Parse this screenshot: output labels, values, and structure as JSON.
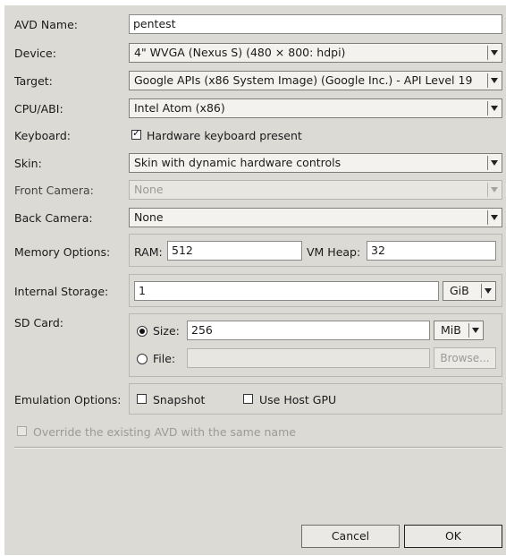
{
  "form": {
    "avd_name_label": "AVD Name:",
    "avd_name_value": "pentest",
    "device_label": "Device:",
    "device_value": "4\" WVGA (Nexus S) (480 × 800: hdpi)",
    "target_label": "Target:",
    "target_value": "Google APIs (x86 System Image) (Google Inc.) - API Level 19",
    "cpu_label": "CPU/ABI:",
    "cpu_value": "Intel Atom (x86)",
    "keyboard_label": "Keyboard:",
    "keyboard_checkbox_label": "Hardware keyboard present",
    "keyboard_checked": true,
    "skin_label": "Skin:",
    "skin_value": "Skin with dynamic hardware controls",
    "front_camera_label": "Front Camera:",
    "front_camera_value": "None",
    "back_camera_label": "Back Camera:",
    "back_camera_value": "None",
    "memory_label": "Memory Options:",
    "ram_label": "RAM:",
    "ram_value": "512",
    "vm_heap_label": "VM Heap:",
    "vm_heap_value": "32",
    "internal_storage_label": "Internal Storage:",
    "internal_storage_value": "1",
    "internal_storage_unit": "GiB",
    "sd_card_label": "SD Card:",
    "sd_size_label": "Size:",
    "sd_size_value": "256",
    "sd_size_unit": "MiB",
    "sd_file_label": "File:",
    "browse_label": "Browse...",
    "emulation_label": "Emulation Options:",
    "snapshot_label": "Snapshot",
    "use_host_gpu_label": "Use Host GPU",
    "override_label": "Override the existing AVD with the same name"
  },
  "buttons": {
    "cancel": "Cancel",
    "ok": "OK"
  },
  "icons": {
    "dropdown": "chevron-down-icon",
    "checkbox": "checkbox-icon",
    "radio": "radio-icon"
  }
}
